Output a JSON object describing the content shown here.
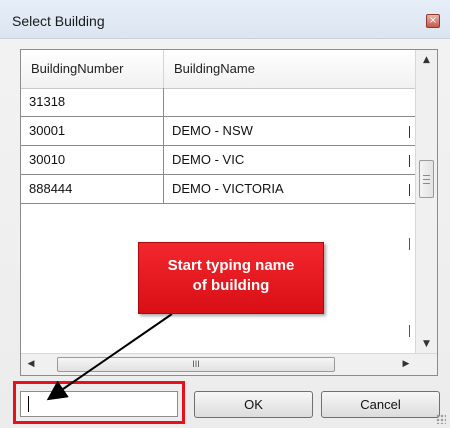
{
  "dialog": {
    "title": "Select Building",
    "close_icon": "close-icon",
    "close_glyph": "×"
  },
  "grid": {
    "columns": [
      "BuildingNumber",
      "BuildingName"
    ],
    "rows": [
      {
        "number": "31318",
        "name": ""
      },
      {
        "number": "30001",
        "name": "DEMO - NSW"
      },
      {
        "number": "30010",
        "name": "DEMO - VIC"
      },
      {
        "number": "888444",
        "name": "DEMO - VICTORIA"
      }
    ],
    "vscroll": {
      "up_glyph": "▲",
      "down_glyph": "▼"
    },
    "hscroll": {
      "left_glyph": "◀",
      "right_glyph": "▶",
      "thumb_glyph": "III"
    }
  },
  "search": {
    "value": ""
  },
  "buttons": {
    "ok": "OK",
    "cancel": "Cancel"
  },
  "callout": {
    "line1": "Start typing name",
    "line2": "of building"
  },
  "colors": {
    "callout": "#e31b22",
    "highlight": "#e8101a"
  }
}
